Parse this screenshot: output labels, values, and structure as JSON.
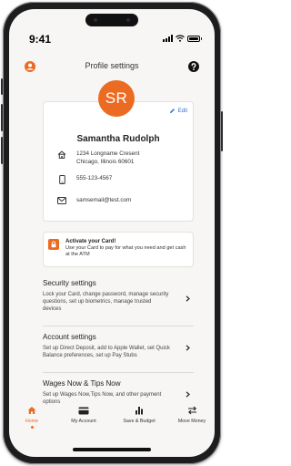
{
  "status": {
    "time": "9:41"
  },
  "header": {
    "title": "Profile settings"
  },
  "profile": {
    "initials": "SR",
    "edit_label": "Edit",
    "name": "Samantha Rudolph",
    "address_line1": "1234 Longname Cresent",
    "address_line2": "Chicago, Illinois 60601",
    "phone": "555-123-4567",
    "email": "samsemail@test.com"
  },
  "activate": {
    "title": "Activate your Card!",
    "body": "Use your Card to pay for what you need and get cash at the ATM"
  },
  "sections": [
    {
      "title": "Security settings",
      "desc": "Lock your Card, change password, manage security questions, set up biometrics, manage trusted devices"
    },
    {
      "title": "Account settings",
      "desc": "Set up Direct Deposit, add to Apple Wallet, set Quick Balance preferences, set up Pay Stubs"
    },
    {
      "title": "Wages Now & Tips Now",
      "desc": "Set up Wages Now,Tips Now, and other payment options"
    }
  ],
  "tabs": [
    {
      "label": "Home",
      "icon": "home-icon",
      "active": true
    },
    {
      "label": "My Account",
      "icon": "card-icon",
      "active": false
    },
    {
      "label": "Save & Budget",
      "icon": "bar-chart-icon",
      "active": false
    },
    {
      "label": "Move Money",
      "icon": "transfer-icon",
      "active": false
    }
  ],
  "colors": {
    "accent": "#EC6B22",
    "link": "#2F6FD0",
    "background": "#F7F6F4"
  }
}
